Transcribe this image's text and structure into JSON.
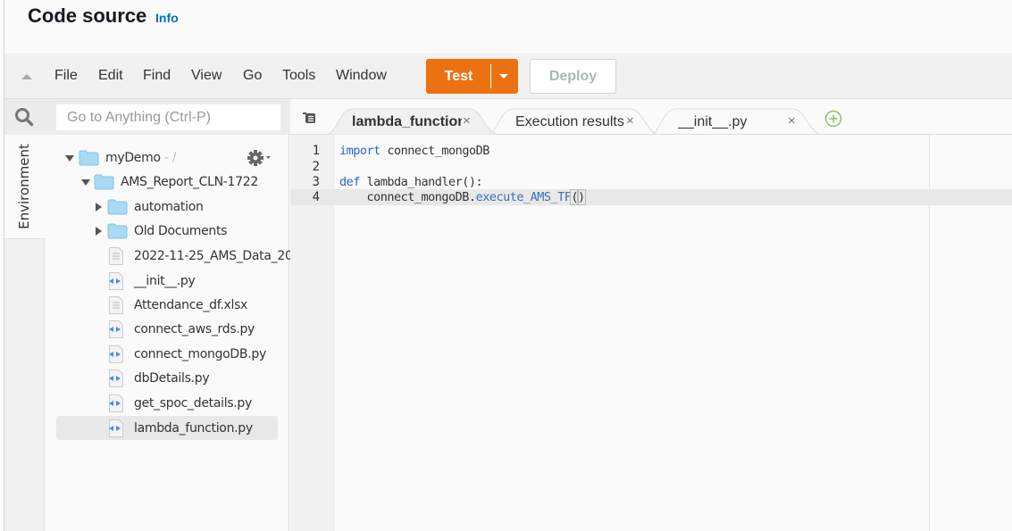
{
  "header": {
    "title": "Code source",
    "info_link": "Info"
  },
  "menubar": {
    "items": [
      "File",
      "Edit",
      "Find",
      "View",
      "Go",
      "Tools",
      "Window"
    ],
    "test_label": "Test",
    "deploy_label": "Deploy",
    "accent_color": "#ec7211"
  },
  "search": {
    "placeholder": "Go to Anything (Ctrl-P)"
  },
  "sidebar": {
    "env_tab": "Environment"
  },
  "tree": {
    "root": {
      "name": "myDemo",
      "suffix": " - /"
    },
    "project": "AMS_Report_CLN-1722",
    "folders": [
      "automation",
      "Old Documents"
    ],
    "files": [
      {
        "name": "2022-11-25_AMS_Data_20",
        "type": "doc"
      },
      {
        "name": "__init__.py",
        "type": "code"
      },
      {
        "name": "Attendance_df.xlsx",
        "type": "doc"
      },
      {
        "name": "connect_aws_rds.py",
        "type": "code"
      },
      {
        "name": "connect_mongoDB.py",
        "type": "code"
      },
      {
        "name": "dbDetails.py",
        "type": "code"
      },
      {
        "name": "get_spoc_details.py",
        "type": "code"
      },
      {
        "name": "lambda_function.py",
        "type": "code",
        "selected": true
      }
    ]
  },
  "tabs": [
    {
      "label": "lambda_function",
      "active": true
    },
    {
      "label": "Execution results",
      "active": false
    },
    {
      "label": "__init__.py",
      "active": false
    }
  ],
  "editor": {
    "line_numbers": [
      "1",
      "2",
      "3",
      "4"
    ],
    "active_line": 4,
    "lines": {
      "l1_kw": "import",
      "l1_rest": " connect_mongoDB",
      "l3_kw": "def",
      "l3_rest": " lambda_handler():",
      "l4_indent": "    connect_mongoDB.",
      "l4_fn": "execute_AMS_TF",
      "l4_open": "(",
      "l4_close": ")"
    }
  }
}
